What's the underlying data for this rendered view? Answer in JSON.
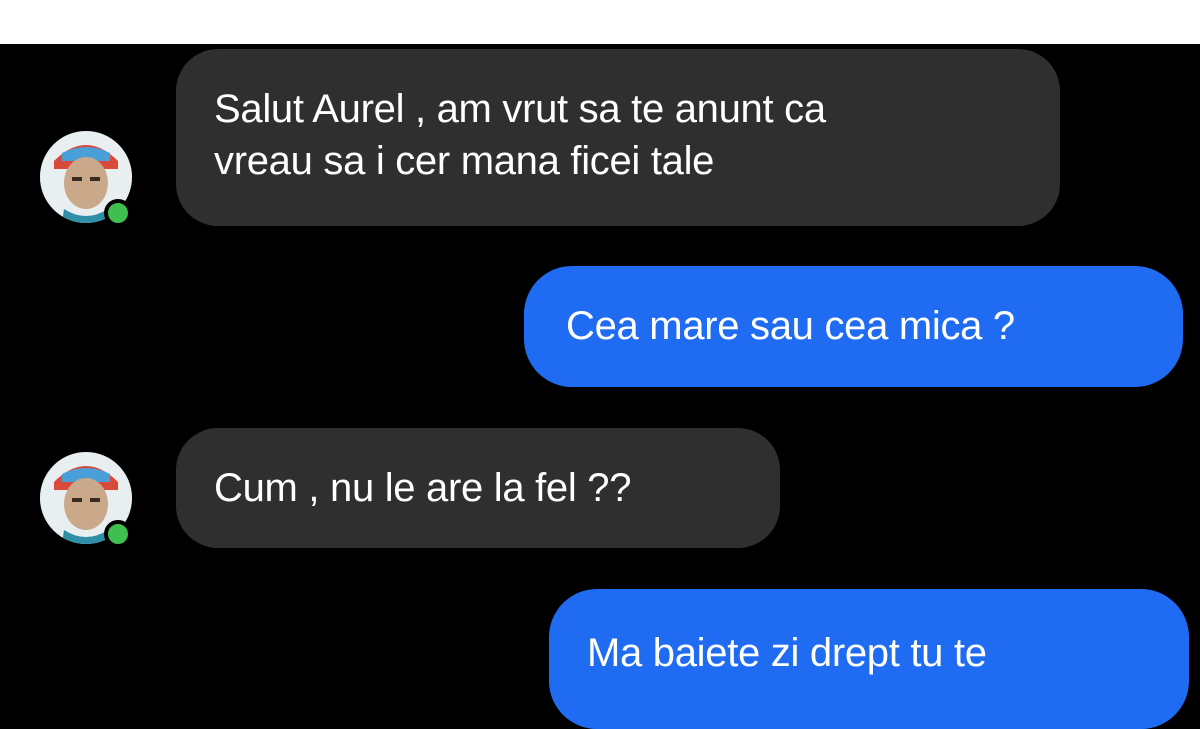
{
  "conversation": {
    "messages": [
      {
        "direction": "incoming",
        "text_lines": [
          "Salut Aurel , am vrut sa te anunt ca",
          "vreau sa i cer mana ficei tale"
        ]
      },
      {
        "direction": "outgoing",
        "text_lines": [
          "Cea mare sau cea mica ?"
        ]
      },
      {
        "direction": "incoming",
        "text_lines": [
          "Cum , nu le are la fel ??"
        ]
      },
      {
        "direction": "outgoing",
        "text_lines": [
          "Ma baiete zi drept tu te"
        ]
      }
    ],
    "contact_online": true
  },
  "colors": {
    "background": "#000000",
    "incoming_bubble": "#2f2f2f",
    "outgoing_bubble": "#1f6cf2",
    "text": "#ffffff",
    "online_indicator": "#3fbf4d"
  },
  "icons": {
    "avatar": "contact-avatar-photo",
    "presence": "online-dot-icon"
  }
}
